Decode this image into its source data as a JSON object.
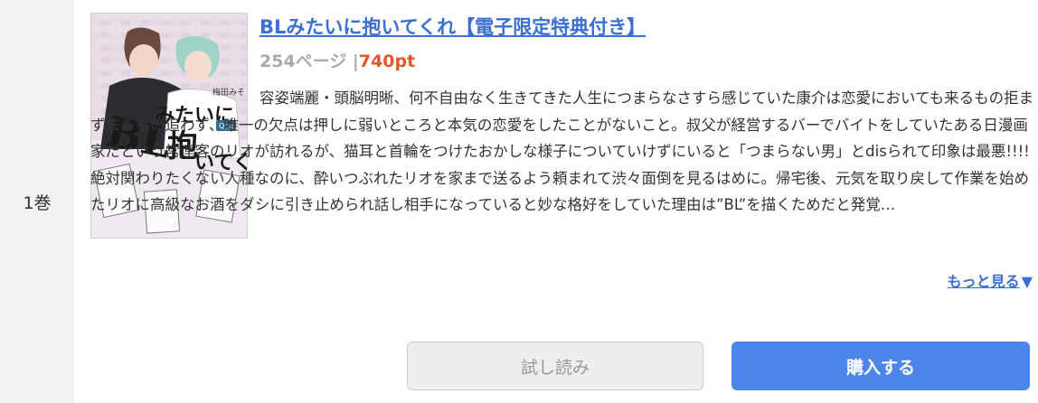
{
  "volume": {
    "label": "1巻"
  },
  "book": {
    "title": "BLみたいに抱いてくれ【電子限定特典付き】",
    "pages": "254ページ",
    "separator": "|",
    "price": "740pt",
    "cover_text": {
      "main": "BLみたいに抱いてくれ",
      "author": "梅田みそ",
      "label": "Qpa"
    },
    "description": "容姿端麗・頭脳明晰、何不自由なく生きてきた人生につまらなさすら感じていた康介は恋愛においても来るもの拒まず去るもの追わず、唯一の欠点は押しに弱いところと本気の恋愛をしたことがないこと。叔父が経営するバーでバイトをしていたある日漫画家だという常連客のリオが訪れるが、猫耳と首輪をつけたおかしな様子についていけずにいると「つまらない男」とdisられて印象は最悪!!!!絶対関わりたくない人種なのに、酔いつぶれたリオを家まで送るよう頼まれて渋々面倒を見るはめに。帰宅後、元気を取り戻して作業を始めたリオに高級なお酒をダシに引き止められ話し相手になっていると妙な格好をしていた理由は”BL”を描くためだと発覚…"
  },
  "more": {
    "label": "もっと見る",
    "arrow": "▼"
  },
  "buttons": {
    "trial": "試し読み",
    "buy": "購入する"
  },
  "colors": {
    "link": "#3b6fd4",
    "price": "#e8552a",
    "buy_button": "#4d86ea",
    "trial_button": "#eeeeee",
    "volume_column": "#f2f2f2"
  }
}
